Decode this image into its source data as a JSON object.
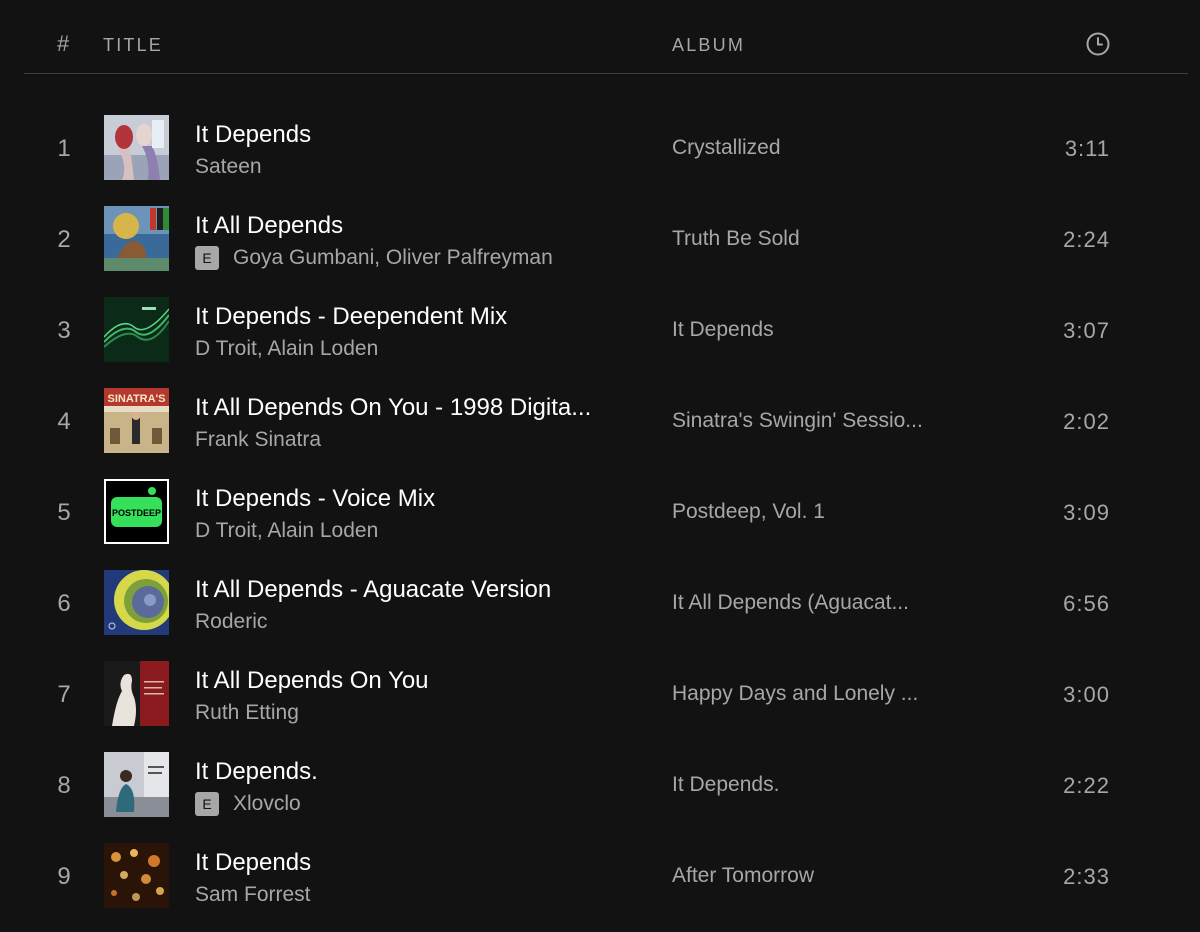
{
  "header": {
    "number_label": "#",
    "title_label": "TITLE",
    "album_label": "ALBUM",
    "duration_icon": "clock-icon"
  },
  "tracks": [
    {
      "number": "1",
      "title": "It Depends",
      "artist": "Sateen",
      "explicit": false,
      "explicit_label": "",
      "album": "Crystallized",
      "duration": "3:11"
    },
    {
      "number": "2",
      "title": "It All Depends",
      "artist": "Goya Gumbani, Oliver Palfreyman",
      "explicit": true,
      "explicit_label": "E",
      "album": "Truth Be Sold",
      "duration": "2:24"
    },
    {
      "number": "3",
      "title": "It Depends - Deependent Mix",
      "artist": "D Troit, Alain Loden",
      "explicit": false,
      "explicit_label": "",
      "album": "It Depends",
      "duration": "3:07"
    },
    {
      "number": "4",
      "title": "It All Depends On You - 1998 Digita...",
      "artist": "Frank Sinatra",
      "explicit": false,
      "explicit_label": "",
      "album": "Sinatra's Swingin' Sessio...",
      "duration": "2:02"
    },
    {
      "number": "5",
      "title": "It Depends - Voice Mix",
      "artist": "D Troit, Alain Loden",
      "explicit": false,
      "explicit_label": "",
      "album": "Postdeep, Vol. 1",
      "duration": "3:09"
    },
    {
      "number": "6",
      "title": "It All Depends - Aguacate Version",
      "artist": "Roderic",
      "explicit": false,
      "explicit_label": "",
      "album": "It All Depends (Aguacat...",
      "duration": "6:56"
    },
    {
      "number": "7",
      "title": "It All Depends On You",
      "artist": "Ruth Etting",
      "explicit": false,
      "explicit_label": "",
      "album": "Happy Days and Lonely ...",
      "duration": "3:00"
    },
    {
      "number": "8",
      "title": "It Depends.",
      "artist": "Xlovclo",
      "explicit": true,
      "explicit_label": "E",
      "album": "It Depends.",
      "duration": "2:22"
    },
    {
      "number": "9",
      "title": "It Depends",
      "artist": "Sam Forrest",
      "explicit": false,
      "explicit_label": "",
      "album": "After Tomorrow",
      "duration": "2:33"
    }
  ],
  "cover_texts": {
    "cover_4": "SINATRA'S",
    "cover_5": "POSTDEEP"
  }
}
